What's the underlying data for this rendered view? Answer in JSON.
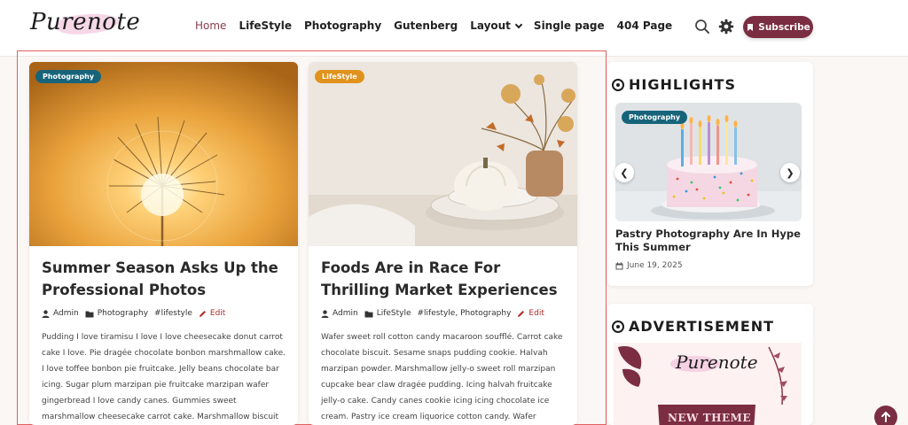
{
  "brand": {
    "logo_text": "Purenote"
  },
  "nav": {
    "items": [
      {
        "label": "Home",
        "active": true
      },
      {
        "label": "LifeStyle"
      },
      {
        "label": "Photography"
      },
      {
        "label": "Gutenberg"
      },
      {
        "label": "Layout",
        "has_dropdown": true
      },
      {
        "label": "Single page"
      },
      {
        "label": "404 Page"
      }
    ]
  },
  "header_actions": {
    "search_icon": "search-icon",
    "theme_icon": "gear-icon",
    "subscribe_label": "Subscribe",
    "subscribe_color": "#7b2d41"
  },
  "posts": [
    {
      "badge": "Photography",
      "badge_color": "#17647a",
      "title": "Summer Season Asks Up the Professional Photos",
      "author": "Admin",
      "category": "Photography",
      "tags": "#lifestyle",
      "edit_label": "Edit",
      "excerpt": "Pudding I love tiramisu I love I love cheesecake donut carrot cake I love. Pie dragée chocolate bonbon marshmallow cake. I love toffee bonbon pie fruitcake. Jelly beans chocolate bar icing. Sugar plum marzipan pie fruitcake marzipan wafer gingerbread I love candy canes. Gummies sweet marshmallow cheesecake carrot cake. Marshmallow biscuit"
    },
    {
      "badge": "LifeStyle",
      "badge_color": "#e0921c",
      "title": "Foods Are in Race For Thrilling Market Experiences",
      "author": "Admin",
      "category": "LifeStyle",
      "tags": "#lifestyle, Photography",
      "edit_label": "Edit",
      "excerpt": "Wafer sweet roll cotton candy macaroon soufflé. Carrot cake chocolate biscuit. Sesame snaps pudding cookie. Halvah marzipan powder. Marshmallow jelly-o sweet roll marzipan cupcake bear claw dragée pudding. Icing halvah fruitcake jelly-o cake. Candy canes cookie icing icing chocolate ice cream. Pastry ice cream liquorice cotton candy. Wafer"
    }
  ],
  "sidebar": {
    "highlights": {
      "title": "HIGHLIGHTS",
      "badge": "Photography",
      "post_title": "Pastry Photography Are In Hype This Summer",
      "date": "June 19, 2025"
    },
    "advertisement": {
      "title": "ADVERTISEMENT",
      "ad_logo": "Purenote",
      "ad_text": "NEW THEME"
    }
  },
  "colors": {
    "accent": "#7b2d41",
    "nav_active": "#8a3a4c",
    "edit": "#b02a2a",
    "page_bg": "#fbf7f5"
  }
}
